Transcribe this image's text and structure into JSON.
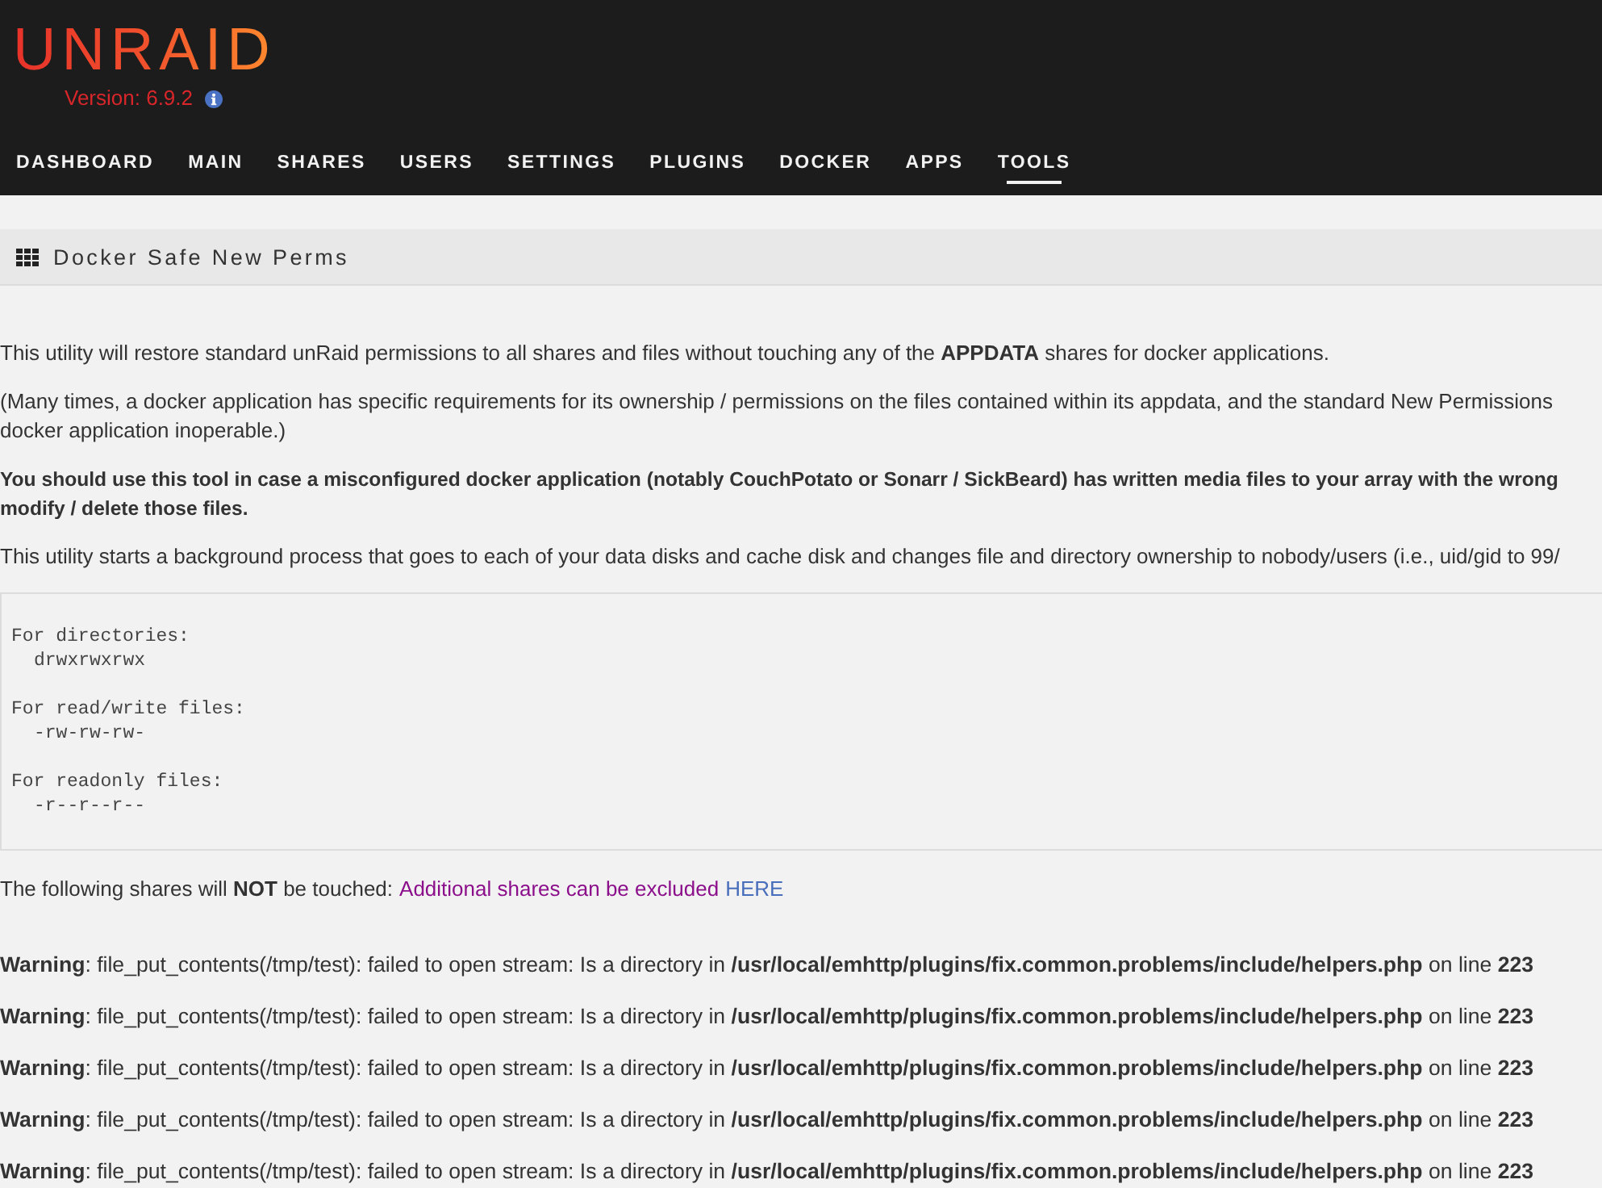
{
  "header": {
    "logo": "UNRAID",
    "version": "Version: 6.9.2"
  },
  "nav": {
    "items": [
      {
        "label": "DASHBOARD",
        "selected": false
      },
      {
        "label": "MAIN",
        "selected": false
      },
      {
        "label": "SHARES",
        "selected": false
      },
      {
        "label": "USERS",
        "selected": false
      },
      {
        "label": "SETTINGS",
        "selected": false
      },
      {
        "label": "PLUGINS",
        "selected": false
      },
      {
        "label": "DOCKER",
        "selected": false
      },
      {
        "label": "APPS",
        "selected": false
      },
      {
        "label": "TOOLS",
        "selected": true
      }
    ]
  },
  "panel": {
    "title": "Docker Safe New Perms"
  },
  "paragraphs": [
    {
      "bold": false,
      "lines": [
        "This utility will restore standard unRaid permissions to all shares and files without touching any of the **APPDATA** shares for docker applications."
      ]
    },
    {
      "bold": false,
      "lines": [
        "(Many times, a docker application has specific requirements for its ownership / permissions on the files contained within its appdata, and the standard New Permissions",
        "docker application inoperable.)"
      ]
    },
    {
      "bold": true,
      "lines": [
        "You should use this tool in case a misconfigured docker application (notably CouchPotato or Sonarr / SickBeard) has written media files to your array with the wrong",
        "modify / delete those files."
      ]
    },
    {
      "bold": false,
      "lines": [
        "This utility starts a background process that goes to each of your data disks and cache disk and changes file and directory ownership to nobody/users (i.e., uid/gid to 99/"
      ]
    }
  ],
  "permissions": [
    {
      "heading": "For directories:",
      "value": "drwxrwxrwx"
    },
    {
      "heading": "For read/write files:",
      "value": "-rw-rw-rw-"
    },
    {
      "heading": "For readonly files:",
      "value": "-r--r--r--"
    }
  ],
  "shares_note": {
    "text": "The following shares will **NOT** be touched:",
    "note": "Additional shares can be excluded",
    "link": "HERE"
  },
  "warnings": [
    "**Warning**: file_put_contents(/tmp/test): failed to open stream: Is a directory in **/usr/local/emhttp/plugins/fix.common.problems/include/helpers.php** on line **223**",
    "**Warning**: file_put_contents(/tmp/test): failed to open stream: Is a directory in **/usr/local/emhttp/plugins/fix.common.problems/include/helpers.php** on line **223**",
    "**Warning**: file_put_contents(/tmp/test): failed to open stream: Is a directory in **/usr/local/emhttp/plugins/fix.common.problems/include/helpers.php** on line **223**",
    "**Warning**: file_put_contents(/tmp/test): failed to open stream: Is a directory in **/usr/local/emhttp/plugins/fix.common.problems/include/helpers.php** on line **223**",
    "**Warning**: file_put_contents(/tmp/test): failed to open stream: Is a directory in **/usr/local/emhttp/plugins/fix.common.problems/include/helpers.php** on line **223**"
  ]
}
